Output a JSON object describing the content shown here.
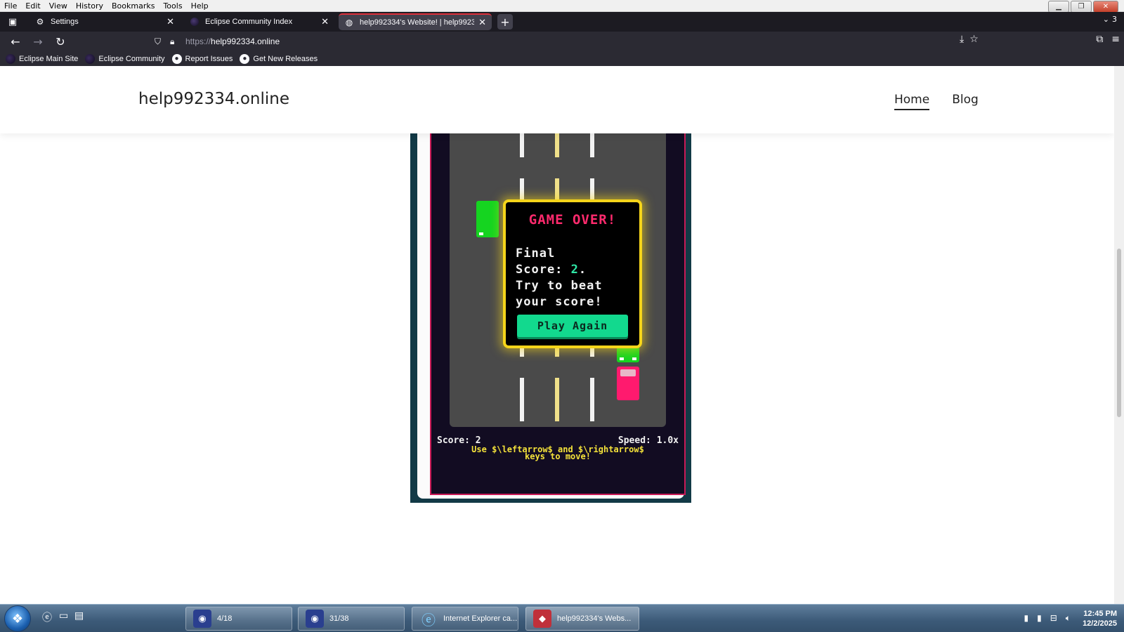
{
  "menubar": {
    "items": [
      "File",
      "Edit",
      "View",
      "History",
      "Bookmarks",
      "Tools",
      "Help"
    ]
  },
  "tabs": [
    {
      "label": "Settings",
      "icon": "gear-icon",
      "active": false
    },
    {
      "label": "Eclipse Community Index",
      "icon": "eclipse-icon",
      "active": false
    },
    {
      "label": "help992334's Website! | help99233",
      "icon": "globe-icon",
      "active": true
    }
  ],
  "tab_overflow_count": "3",
  "url": {
    "protocol": "https://",
    "host": "help992334.online"
  },
  "bookmarks": [
    {
      "label": "Eclipse Main Site",
      "icon": "eclipse-icon"
    },
    {
      "label": "Eclipse Community",
      "icon": "eclipse-icon"
    },
    {
      "label": "Report Issues",
      "icon": "github-icon"
    },
    {
      "label": "Get New Releases",
      "icon": "github-icon"
    }
  ],
  "site": {
    "title": "help992334.online",
    "nav": [
      {
        "label": "Home",
        "active": true
      },
      {
        "label": "Blog",
        "active": false
      }
    ]
  },
  "game": {
    "gameover_title": "GAME OVER!",
    "final_line1": "Final",
    "final_score_label": "Score: ",
    "final_score_value": "2",
    "final_score_suffix": ".",
    "final_line3": "Try to beat",
    "final_line4": "your score!",
    "play_again": "Play Again",
    "score_text": "Score: 2",
    "speed_text": "Speed: 1.0x",
    "help_line1": "Use $\\leftarrow$ and $\\rightarrow$",
    "help_line2": "keys to move!",
    "colors": {
      "road": "#4a4a4a",
      "player": "#ff1a6e",
      "enemy": "#15d420",
      "frame": "#f6d51a",
      "title": "#ff2a6d",
      "button": "#12d98e"
    }
  },
  "taskbar": {
    "items": [
      {
        "label": "4/18",
        "icon": "app-icon"
      },
      {
        "label": "31/38",
        "icon": "app-icon"
      },
      {
        "label": "Internet Explorer ca...",
        "icon": "ie-icon"
      },
      {
        "label": "help992334's Webs...",
        "icon": "browser-icon"
      }
    ],
    "time": "12:45 PM",
    "date": "12/2/2025"
  }
}
